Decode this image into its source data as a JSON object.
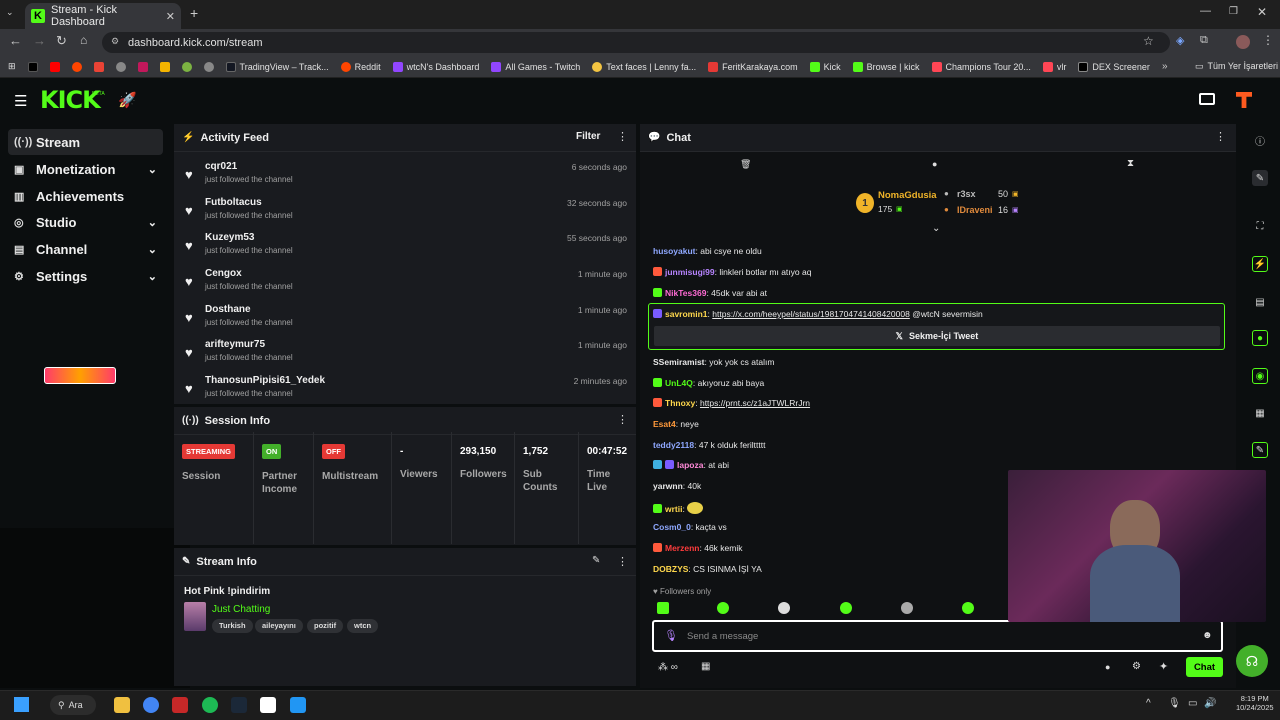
{
  "browser": {
    "tab_title": "Stream - Kick Dashboard",
    "url": "dashboard.kick.com/stream",
    "bookmarks": [
      "TradingView – Track...",
      "Reddit",
      "wtcN's Dashboard",
      "All Games - Twitch",
      "Text faces | Lenny fa...",
      "FeritKarakaya.com",
      "Kick",
      "Browse | kick",
      "Champions Tour 20...",
      "vlr",
      "DEX Screener"
    ],
    "bookmarks_folder": "Tüm Yer İşaretleri"
  },
  "brand": {
    "logo": "KICK",
    "beta": "BETA",
    "accent": "#53fc18"
  },
  "sidebar": {
    "items": [
      {
        "label": "Stream",
        "icon": "broadcast-icon"
      },
      {
        "label": "Monetization",
        "icon": "wallet-icon"
      },
      {
        "label": "Achievements",
        "icon": "trophy-icon"
      },
      {
        "label": "Studio",
        "icon": "studio-icon"
      },
      {
        "label": "Channel",
        "icon": "channel-icon"
      },
      {
        "label": "Settings",
        "icon": "gear-icon"
      }
    ]
  },
  "activity": {
    "title": "Activity Feed",
    "filter": "Filter",
    "items": [
      {
        "name": "cqr021",
        "action": "just followed the channel",
        "time": "6 seconds ago"
      },
      {
        "name": "Futboltacus",
        "action": "just followed the channel",
        "time": "32 seconds ago"
      },
      {
        "name": "Kuzeym53",
        "action": "just followed the channel",
        "time": "55 seconds ago"
      },
      {
        "name": "Cengox",
        "action": "just followed the channel",
        "time": "1 minute ago"
      },
      {
        "name": "Dosthane",
        "action": "just followed the channel",
        "time": "1 minute ago"
      },
      {
        "name": "arifteymur75",
        "action": "just followed the channel",
        "time": "1 minute ago"
      },
      {
        "name": "ThanosunPipisi61_Yedek",
        "action": "just followed the channel",
        "time": "2 minutes ago"
      }
    ]
  },
  "session": {
    "title": "Session Info",
    "stats": [
      {
        "value": "STREAMING",
        "label": "Session"
      },
      {
        "value": "ON",
        "label": "Partner Income"
      },
      {
        "value": "OFF",
        "label": "Multistream"
      },
      {
        "value": "-",
        "label": "Viewers"
      },
      {
        "value": "293,150",
        "label": "Followers"
      },
      {
        "value": "1,752",
        "label": "Sub Counts"
      },
      {
        "value": "00:47:52",
        "label": "Time Live"
      }
    ]
  },
  "stream_info": {
    "title": "Stream Info",
    "stream_title": "Hot Pink !pindirim",
    "category": "Just Chatting",
    "tags": [
      "Turkish",
      "aileyayını",
      "pozitif",
      "wtcn"
    ]
  },
  "chat": {
    "title": "Chat",
    "leaderboard": [
      {
        "name": "NomaGdusia",
        "value": "175"
      },
      {
        "name": "r3sx",
        "value": "50"
      },
      {
        "name": "IDraveni",
        "value": "16"
      }
    ],
    "messages": [
      {
        "user": "husoyakut",
        "text": "abi csye ne oldu",
        "color": "#8fa8ff"
      },
      {
        "user": "junmisugi99",
        "text": "linkleri botlar mı atıyo aq",
        "color": "#b784ff"
      },
      {
        "user": "NikTes369",
        "text": "45dk var abi at",
        "color": "#ff6bd5"
      },
      {
        "user": "savromin1",
        "text": "https://x.com/heeypel/status/1981704741408420008",
        "mention": "@wtcN severmisin",
        "color": "#ffd84d"
      },
      {
        "user": "SSemiramist",
        "text": "yok yok cs atalım",
        "color": "#e8e8e8"
      },
      {
        "user": "UnL4Q",
        "text": "akıyoruz abi baya",
        "color": "#53fc18"
      },
      {
        "user": "Thnoxy",
        "text": "https://prnt.sc/z1aJTWLRrJrn",
        "color": "#ffd84d"
      },
      {
        "user": "Esat4",
        "text": "neye",
        "color": "#ff9a3c"
      },
      {
        "user": "teddy2118",
        "text": "47 k olduk ferilttttt",
        "color": "#8fa8ff"
      },
      {
        "user": "lapoza",
        "text": "at abi",
        "color": "#ff8ad8"
      },
      {
        "user": "yarwnn",
        "text": "40k",
        "color": "#e8e8e8"
      },
      {
        "user": "wrtii",
        "text": "",
        "color": "#ffd84d"
      },
      {
        "user": "Cosm0_0",
        "text": "kaçta vs",
        "color": "#8fa8ff"
      },
      {
        "user": "Merzenn",
        "text": "46k kemik",
        "color": "#ff3c3c"
      },
      {
        "user": "DOBZYS",
        "text": "CS ISINMA İŞİ YA",
        "color": "#ffd84d"
      }
    ],
    "tweet_button": "Sekme-İçi Tweet",
    "followers_only": "Followers only",
    "input_placeholder": "Send a message",
    "send_label": "Chat"
  },
  "taskbar": {
    "search": "Ara",
    "time": "8:19 PM",
    "date": "10/24/2025"
  }
}
